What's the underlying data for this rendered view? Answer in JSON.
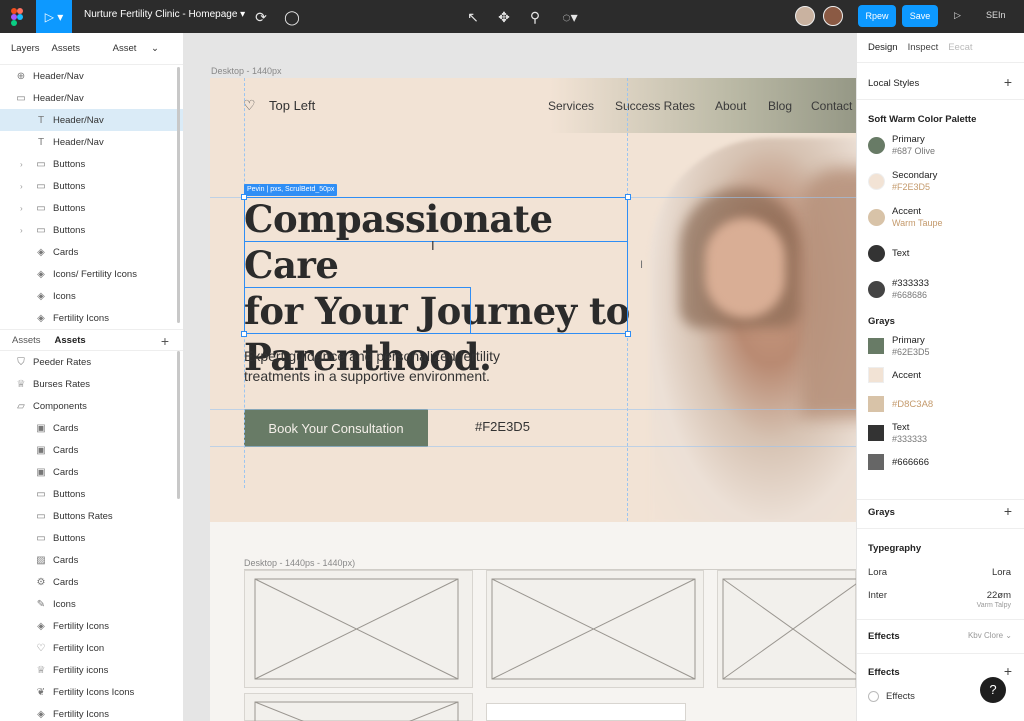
{
  "topbar": {
    "file_name": "Nurture Fertility Clinic - Homepage",
    "primary_button": "Rpew",
    "save_button": "Save",
    "share_label": "SEIn"
  },
  "left_panel": {
    "tabs": [
      "Layers",
      "Assets"
    ],
    "asset_dropdown": "Asset",
    "layers": [
      {
        "label": "Header/Nav",
        "icon": "grid-icon",
        "indent": 0,
        "chevron": false,
        "selected": false
      },
      {
        "label": "Header/Nav",
        "icon": "frame-icon",
        "indent": 0,
        "chevron": false,
        "selected": false
      },
      {
        "label": "Header/Nav",
        "icon": "text-icon",
        "indent": 1,
        "chevron": false,
        "selected": true
      },
      {
        "label": "Header/Nav",
        "icon": "text-icon",
        "indent": 1,
        "chevron": false,
        "selected": false
      },
      {
        "label": "Buttons",
        "icon": "button-icon",
        "indent": 1,
        "chevron": true,
        "selected": false
      },
      {
        "label": "Buttons",
        "icon": "button-icon",
        "indent": 1,
        "chevron": true,
        "selected": false
      },
      {
        "label": "Buttons",
        "icon": "button-icon",
        "indent": 1,
        "chevron": true,
        "selected": false
      },
      {
        "label": "Buttons",
        "icon": "button-icon",
        "indent": 1,
        "chevron": true,
        "selected": false
      },
      {
        "label": "Cards",
        "icon": "component-icon",
        "indent": 1,
        "chevron": false,
        "selected": false
      },
      {
        "label": "Icons/ Fertility Icons",
        "icon": "component-icon",
        "indent": 1,
        "chevron": false,
        "selected": false
      },
      {
        "label": "Icons",
        "icon": "component-icon",
        "indent": 1,
        "chevron": false,
        "selected": false
      },
      {
        "label": "Fertility Icons",
        "icon": "component-icon",
        "indent": 1,
        "chevron": false,
        "selected": false
      }
    ],
    "assets_section": {
      "label_a": "Assets",
      "label_b": "Assets"
    },
    "assets": [
      {
        "label": "Peeder Rates",
        "icon": "shield-icon",
        "indent": 0
      },
      {
        "label": "Burses Rates",
        "icon": "trophy-icon",
        "indent": 0
      },
      {
        "label": "Components",
        "icon": "folder-icon",
        "indent": 0
      },
      {
        "label": "Cards",
        "icon": "card-icon",
        "indent": 1
      },
      {
        "label": "Cards",
        "icon": "card-icon",
        "indent": 1
      },
      {
        "label": "Cards",
        "icon": "card-icon",
        "indent": 1
      },
      {
        "label": "Buttons",
        "icon": "button-icon",
        "indent": 1
      },
      {
        "label": "Buttons Rates",
        "icon": "button-icon",
        "indent": 1
      },
      {
        "label": "Buttons",
        "icon": "button-icon",
        "indent": 1
      },
      {
        "label": "Cards",
        "icon": "image-icon",
        "indent": 1
      },
      {
        "label": "Cards",
        "icon": "gear-icon",
        "indent": 1
      },
      {
        "label": "Icons",
        "icon": "pen-icon",
        "indent": 1
      },
      {
        "label": "Fertility Icons",
        "icon": "component-icon",
        "indent": 1
      },
      {
        "label": "Fertility Icon",
        "icon": "heart-icon",
        "indent": 1
      },
      {
        "label": "Fertility icons",
        "icon": "trophy-icon",
        "indent": 1
      },
      {
        "label": "Fertility Icons Icons",
        "icon": "leaf-icon",
        "indent": 1
      },
      {
        "label": "Fertility Icons",
        "icon": "component-icon",
        "indent": 1
      }
    ]
  },
  "canvas": {
    "frame_label": "Desktop - 1440px",
    "lower_frame_label": "Desktop - 1440ps - 1440px)",
    "selection_tag": "Pevin | pxs, ScrulBetd_50px",
    "site": {
      "logo_text": "Top Left",
      "nav": [
        "Services",
        "Success Rates",
        "About",
        "Blog",
        "Contact"
      ],
      "headline": [
        "Compassionate Care",
        "for Your Journey to",
        "Parenthood."
      ],
      "subheadline": "Expert guidance and personalized fertility treatments in a supportive environment.",
      "cta": "Book Your Consultation",
      "hex_label": "#F2E3D5"
    }
  },
  "right_panel": {
    "tabs": [
      "Design",
      "Inspect",
      "Eecat"
    ],
    "local_styles": "Local Styles",
    "palette_title": "Soft Warm Color Palette",
    "palette": [
      {
        "name": "Primary",
        "value": "#687 Olive",
        "color": "#687b66",
        "value_color": "#777777"
      },
      {
        "name": "Secondary",
        "value": "#F2E3D5",
        "color": "#f2e3d5",
        "value_color": "#c49a6c"
      },
      {
        "name": "Accent",
        "value": "Warm Taupe",
        "color": "#d8c3a8",
        "value_color": "#c49a6c"
      },
      {
        "name": "Text",
        "value": "",
        "color": "#333333",
        "value_color": "#777777"
      },
      {
        "name": "#333333",
        "value": "#668686",
        "color": "#444444",
        "value_color": "#777777"
      }
    ],
    "grays_title": "Grays",
    "grays": [
      {
        "name": "Primary",
        "value": "#62E3D5",
        "color": "#687b66",
        "value_color": "#777777"
      },
      {
        "name": "Accent",
        "value": "",
        "color": "#f2e3d5",
        "value_color": "#777777"
      },
      {
        "name": "#D8C3A8",
        "value": "",
        "color": "#d8c3a8",
        "value_color": "#c49a6c"
      },
      {
        "name": "Text",
        "value": "#333333",
        "color": "#333333",
        "value_color": "#777777"
      },
      {
        "name": "#666666",
        "value": "",
        "color": "#666666",
        "value_color": "#777777"
      }
    ],
    "grays_section": "Grays",
    "typography_title": "Typegraphy",
    "typography": [
      {
        "name": "Lora",
        "value": "Lora",
        "note": ""
      },
      {
        "name": "Inter",
        "value": "22øm",
        "note": "Varm Talpy"
      }
    ],
    "effects_title": "Effects",
    "effects_dropdown": "Kbv Clore",
    "effects_title_2": "Effects",
    "effects_item": "Effects",
    "help": "?"
  }
}
